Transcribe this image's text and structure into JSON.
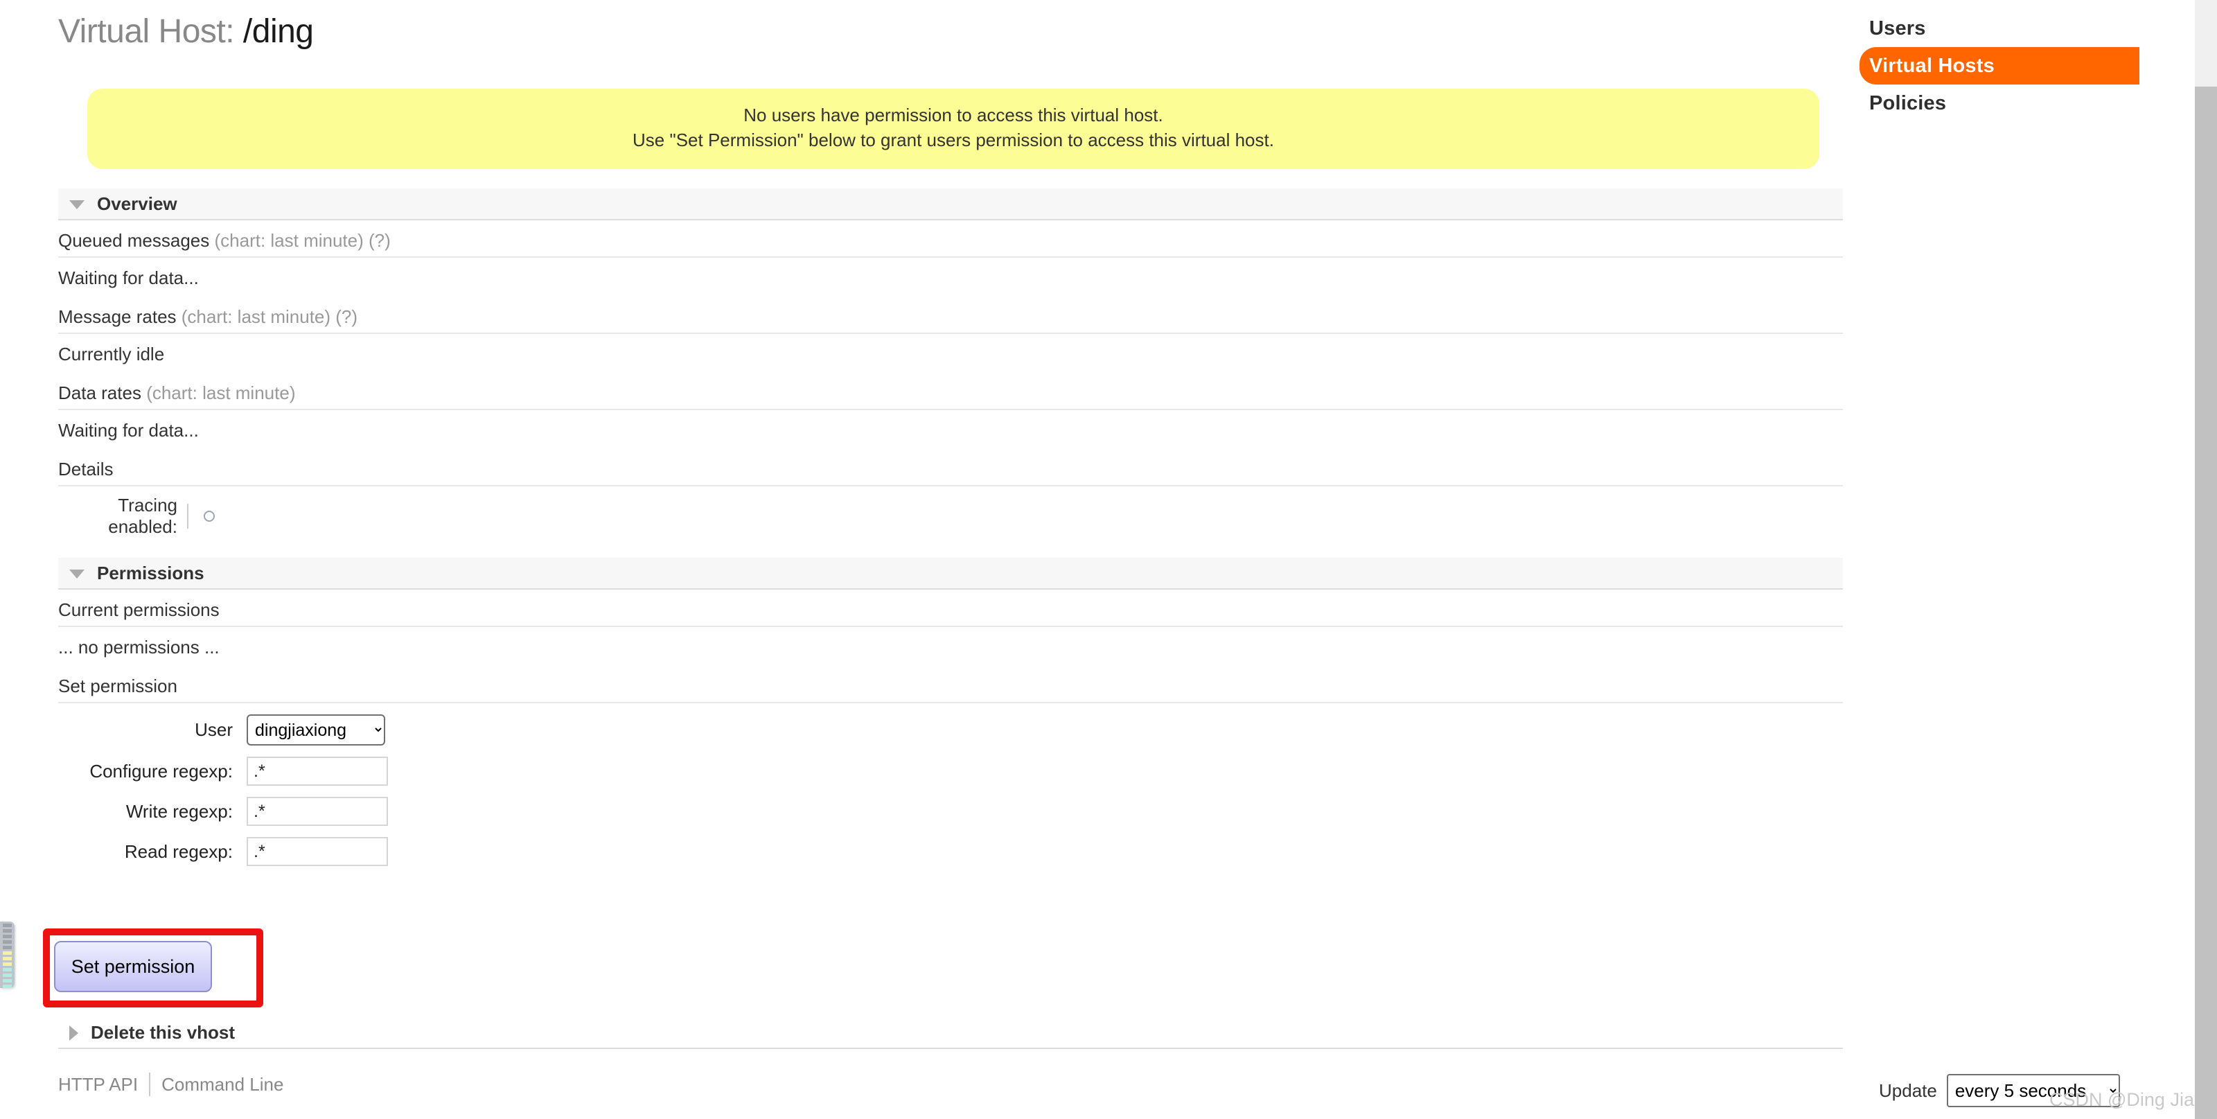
{
  "page": {
    "title_prefix": "Virtual Host:",
    "vhost_name": "/ding"
  },
  "warning": {
    "line1": "No users have permission to access this virtual host.",
    "line2": "Use \"Set Permission\" below to grant users permission to access this virtual host."
  },
  "nav": {
    "items": [
      {
        "label": "Users",
        "active": false
      },
      {
        "label": "Virtual Hosts",
        "active": true
      },
      {
        "label": "Policies",
        "active": false
      }
    ]
  },
  "overview": {
    "heading": "Overview",
    "queued_messages_label": "Queued messages",
    "queued_messages_note": "(chart: last minute) (?)",
    "queued_messages_status": "Waiting for data...",
    "message_rates_label": "Message rates",
    "message_rates_note": "(chart: last minute) (?)",
    "message_rates_status": "Currently idle",
    "data_rates_label": "Data rates",
    "data_rates_note": "(chart: last minute)",
    "data_rates_status": "Waiting for data...",
    "details_label": "Details",
    "tracing_label": "Tracing enabled:",
    "tracing_value": "off"
  },
  "permissions": {
    "heading": "Permissions",
    "current_label": "Current permissions",
    "current_value": "... no permissions ...",
    "set_label": "Set permission",
    "form": {
      "user_label": "User",
      "user_value": "dingjiaxiong",
      "user_options": [
        "dingjiaxiong"
      ],
      "configure_label": "Configure regexp:",
      "configure_value": ".*",
      "write_label": "Write regexp:",
      "write_value": ".*",
      "read_label": "Read regexp:",
      "read_value": ".*",
      "submit_label": "Set permission"
    }
  },
  "delete": {
    "heading": "Delete this vhost"
  },
  "footer": {
    "http_api": "HTTP API",
    "command_line": "Command Line"
  },
  "update": {
    "label": "Update",
    "value": "every 5 seconds",
    "options": [
      "every 5 seconds"
    ]
  },
  "watermark": {
    "text": "CSDN @Ding Jiaxiong"
  },
  "colors": {
    "accent": "#ff6600",
    "warning_bg": "#fdfd96",
    "annotation": "#ee1111"
  }
}
